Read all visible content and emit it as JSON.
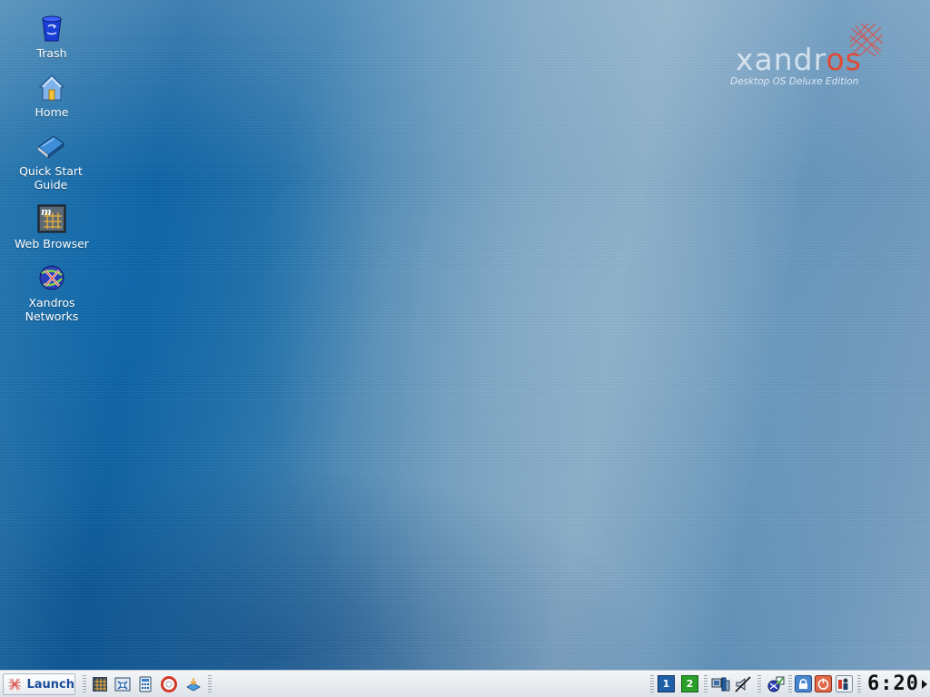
{
  "desktop": {
    "icons": [
      {
        "label": "Trash",
        "icon": "trash-icon"
      },
      {
        "label": "Home",
        "icon": "home-icon"
      },
      {
        "label": "Quick Start\nGuide",
        "icon": "book-icon"
      },
      {
        "label": "Web Browser",
        "icon": "web-browser-icon"
      },
      {
        "label": "Xandros\nNetworks",
        "icon": "xandros-networks-icon"
      }
    ],
    "logo": {
      "word_main": "xandr",
      "word_accent": "os",
      "edition": "Desktop OS Deluxe Edition",
      "accent_color": "#e04a33"
    }
  },
  "taskbar": {
    "launch_label": "Launch",
    "quick_launch": [
      "file-manager-icon",
      "control-center-icon",
      "calculator-icon",
      "help-icon",
      "install-icon"
    ],
    "virtual_desktops": [
      {
        "label": "1",
        "active": true,
        "color": "#1e5fa8"
      },
      {
        "label": "2",
        "active": false,
        "color": "#2aa02a"
      }
    ],
    "tray": [
      "network-icon",
      "volume-muted-icon",
      "update-icon",
      "lock-icon",
      "power-icon",
      "user-icon"
    ],
    "clock": "6:20"
  }
}
